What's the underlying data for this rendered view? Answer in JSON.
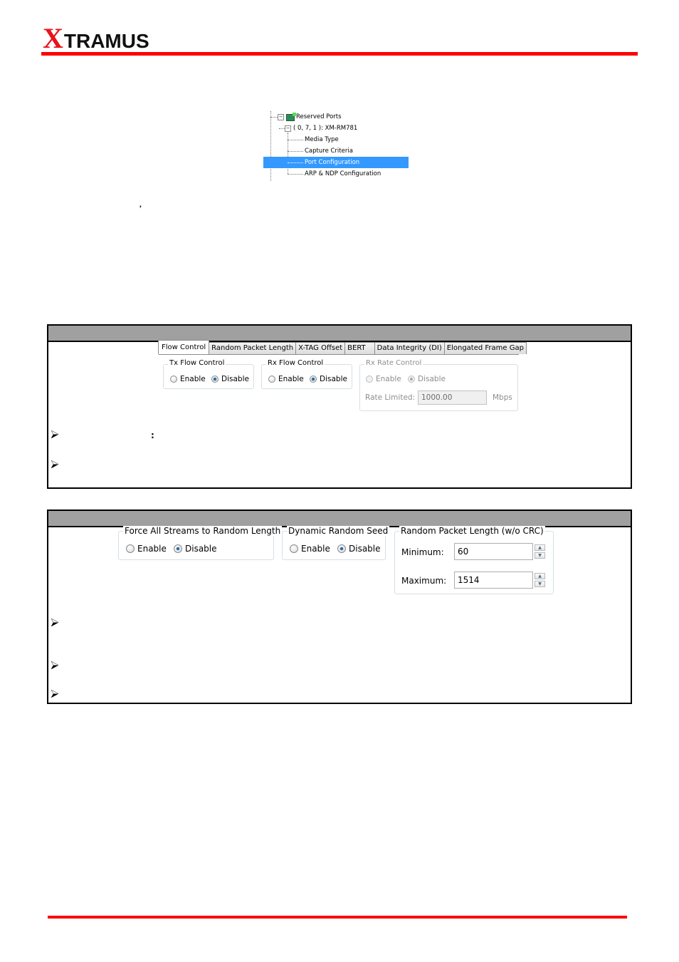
{
  "header": {
    "logo_x": "X",
    "logo_rest": "TRAMUS",
    "accent_color": "#ff0000"
  },
  "tree": {
    "items": [
      {
        "label": "Reserved Ports",
        "icon": "network-ports-icon",
        "expanded": true
      },
      {
        "label": "( 0, 7, 1 ): XM-RM781",
        "expanded": true
      },
      {
        "label": "Media Type"
      },
      {
        "label": "Capture Criteria"
      },
      {
        "label": "Port Configuration",
        "selected": true
      },
      {
        "label": "ARP & NDP Configuration"
      }
    ],
    "selection_color": "#3399ff"
  },
  "stray_marks": {
    "comma": ",",
    "colon": ":"
  },
  "flow_control_box": {
    "tabs": [
      {
        "label": "Flow Control",
        "active": true
      },
      {
        "label": "Random Packet Length"
      },
      {
        "label": "X-TAG Offset"
      },
      {
        "label": "BERT"
      },
      {
        "label": "Data Integrity (DI)"
      },
      {
        "label": "Elongated Frame Gap"
      }
    ],
    "tx_flow_control": {
      "title": "Tx Flow Control",
      "options": [
        "Enable",
        "Disable"
      ],
      "selected": "Disable"
    },
    "rx_flow_control": {
      "title": "Rx Flow Control",
      "options": [
        "Enable",
        "Disable"
      ],
      "selected": "Disable"
    },
    "rx_rate_control": {
      "title": "Rx Rate Control",
      "options": [
        "Enable",
        "Disable"
      ],
      "selected": "Disable",
      "disabled": true,
      "rate_label": "Rate Limited:",
      "rate_value": "1000.00",
      "rate_unit": "Mbps"
    },
    "bullets": 2
  },
  "random_length_box": {
    "force_all": {
      "title": "Force All Streams to Random Length",
      "options": [
        "Enable",
        "Disable"
      ],
      "selected": "Disable"
    },
    "dynamic_seed": {
      "title": "Dynamic Random Seed",
      "options": [
        "Enable",
        "Disable"
      ],
      "selected": "Disable"
    },
    "packet_length": {
      "title": "Random Packet Length (w/o CRC)",
      "minimum_label": "Minimum:",
      "minimum_value": "60",
      "maximum_label": "Maximum:",
      "maximum_value": "1514"
    },
    "bullets": 3
  }
}
